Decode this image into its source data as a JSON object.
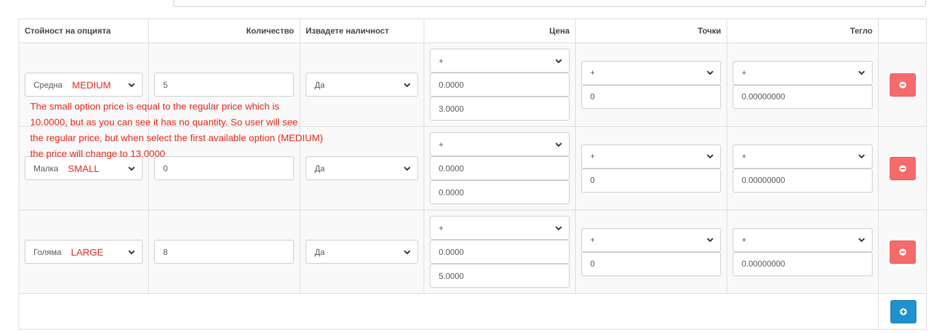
{
  "headers": {
    "option_value": "Стойност на опцията",
    "quantity": "Количество",
    "subtract": "Извадете наличност",
    "price": "Цена",
    "points": "Точки",
    "weight": "Тегло"
  },
  "rows": [
    {
      "option": "Средна",
      "note": "MEDIUM",
      "quantity": "5",
      "subtract": "Да",
      "price_prefix": "+",
      "price": "0.0000",
      "extra_price": "3.0000",
      "points_prefix": "+",
      "points": "0",
      "weight_prefix": "+",
      "weight": "0.00000000"
    },
    {
      "option": "Малка",
      "note": "SMALL",
      "quantity": "0",
      "subtract": "Да",
      "price_prefix": "+",
      "price": "0.0000",
      "extra_price": "0.0000",
      "points_prefix": "+",
      "points": "0",
      "weight_prefix": "+",
      "weight": "0.00000000"
    },
    {
      "option": "Голяма",
      "note": "LARGE",
      "quantity": "8",
      "subtract": "Да",
      "price_prefix": "+",
      "price": "0.0000",
      "extra_price": "5.0000",
      "points_prefix": "+",
      "points": "0",
      "weight_prefix": "+",
      "weight": "0.00000000"
    }
  ],
  "annotation": {
    "line1": "The small option price is equal to the regular price which is",
    "line2": "10.0000, but as you can see it has no quantity. So user will see",
    "line3": "the regular price, but when select the first available option (MEDIUM)",
    "line4": "the price will change to 13.0000"
  },
  "colors": {
    "annotation": "#e8261c",
    "remove_button": "#f56b6b",
    "add_button": "#1e91cf"
  },
  "icons": {
    "remove": "minus-circle-icon",
    "add": "plus-circle-icon",
    "select": "chevron-down-icon"
  }
}
